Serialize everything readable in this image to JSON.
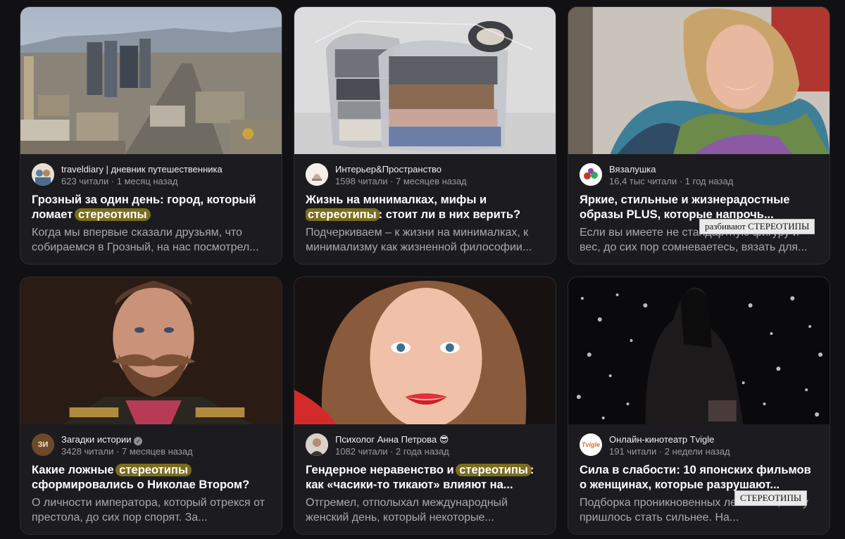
{
  "cards": [
    {
      "channel": "traveldiary | дневник путешественника",
      "stats": "623 читали · 1 месяц назад",
      "title_before": "Грозный за один день: город, который ломает",
      "title_highlight": "стереотипы",
      "title_after": "",
      "description": "Когда мы впервые сказали друзьям, что собираемся в Грозный, на нас посмотрел...",
      "avatar_icon": "travel-avatar-icon",
      "image": "city-skyline-image"
    },
    {
      "channel": "Интерьер&Пространство",
      "stats": "1598 читали · 7 месяцев назад",
      "title_before": "Жизнь на минималках, мифы и",
      "title_highlight": "стереотипы",
      "title_after": ": стоит ли в них верить?",
      "description": "Подчеркиваем – к жизни на минималках, к минимализму как жизненной философии...",
      "avatar_icon": "interior-avatar-icon",
      "image": "vacuum-bags-image"
    },
    {
      "channel": "Вязалушка",
      "stats": "16,4 тыс читали · 1 год назад",
      "title_before": "Яркие, стильные и жизнерадостные образы PLUS, которые напрочь...",
      "title_highlight": "",
      "title_after": "",
      "description": "Если вы имеете не стандартную фигуру и вес, до сих пор сомневаетесь, вязать для...",
      "avatar_icon": "knitting-avatar-icon",
      "image": "woman-scarf-image"
    },
    {
      "channel": "Загадки истории",
      "verified": "✓",
      "stats": "3428 читали · 7 месяцев назад",
      "title_before": "Какие ложные",
      "title_highlight": "стереотипы",
      "title_after": "сформировались о Николае Втором?",
      "description": "О личности императора, который отрекся от престола, до сих пор спорят. За...",
      "avatar_icon": "history-avatar-icon",
      "avatar_text": "ЗИ",
      "image": "emperor-portrait-image"
    },
    {
      "channel": "Психолог Анна Петрова 😎",
      "stats": "1082 читали · 2 года назад",
      "title_before": "Гендерное неравенство и",
      "title_highlight": "стереотипы",
      "title_after": ": как «часики-то тикают» влияют на...",
      "description": "Отгремел, отполыхал международный женский день, который некоторые...",
      "avatar_icon": "psychologist-avatar-icon",
      "image": "woman-portrait-image"
    },
    {
      "channel": "Онлайн-кинотеатр Tvigle",
      "stats": "191 читали · 2 недели назад",
      "title_before": "Сила в слабости: 10 японских фильмов о женщинах, которые разрушают...",
      "title_highlight": "",
      "title_after": "",
      "description": "Подборка проникновенных лент о тех, кому пришлось стать сильнее. На...",
      "avatar_icon": "tvigle-avatar-icon",
      "avatar_text": "Tvigle",
      "image": "night-water-image"
    }
  ],
  "tooltips": {
    "tooltip_1": "разбивают СТЕРЕОТИПЫ",
    "tooltip_2": "СТЕРЕОТИПЫ"
  },
  "colors": {
    "background": "#111114",
    "card": "#1c1c20",
    "highlight": "#7b6d1e"
  }
}
